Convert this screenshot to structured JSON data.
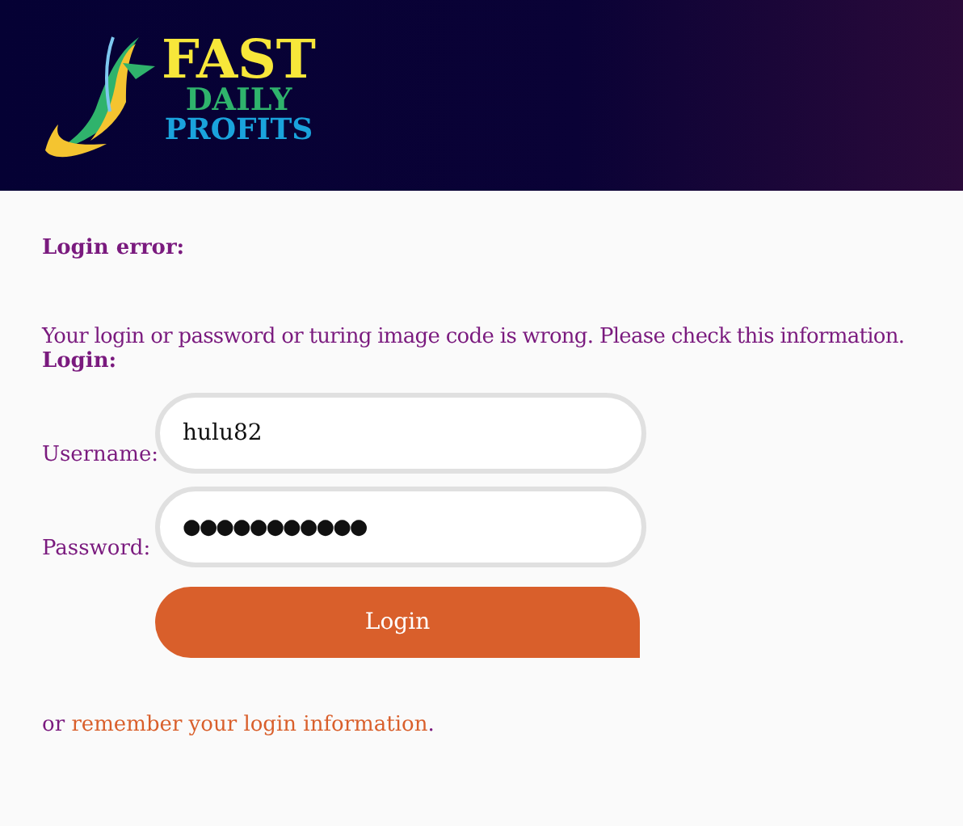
{
  "logo": {
    "lines": [
      "FAST",
      "DAILY",
      "PROFITS"
    ]
  },
  "error": {
    "title": "Login error:",
    "message": "Your login or password or turing image code is wrong. Please check this information."
  },
  "form": {
    "title": "Login:",
    "fields": [
      {
        "label": "Username:",
        "value": "hulu82",
        "kind": "text"
      },
      {
        "label": "Password:",
        "value": "●●●●●●●●●●●",
        "kind": "password"
      }
    ],
    "submit": "Login"
  },
  "footer": {
    "before": "or ",
    "link": "remember your login information",
    "after": "."
  }
}
